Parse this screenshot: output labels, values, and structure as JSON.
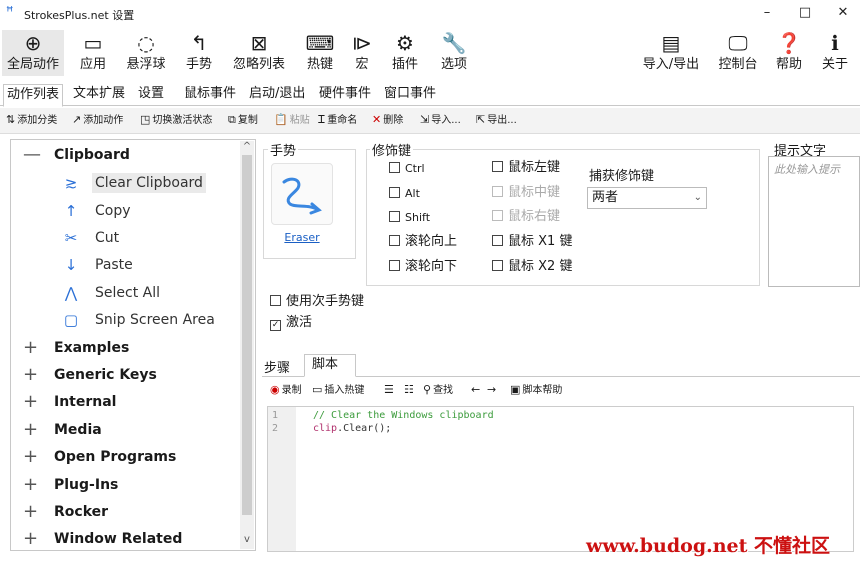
{
  "window": {
    "title": "StrokesPlus.net 设置",
    "minimize": "–",
    "maximize": "□",
    "close": "✕"
  },
  "toolbar": {
    "left": [
      {
        "label": "全局动作",
        "icon": "globe-icon",
        "glyph": "⊕"
      },
      {
        "label": "应用",
        "icon": "window-icon",
        "glyph": "▭"
      },
      {
        "label": "悬浮球",
        "icon": "circle-dots-icon",
        "glyph": "◌"
      },
      {
        "label": "手势",
        "icon": "gesture-arrow-icon",
        "glyph": "↰"
      },
      {
        "label": "忽略列表",
        "icon": "ignore-windows-icon",
        "glyph": "⊠"
      },
      {
        "label": "热键",
        "icon": "keyboard-icon",
        "glyph": "⌨"
      },
      {
        "label": "宏",
        "icon": "macro-icon",
        "glyph": "⧐"
      },
      {
        "label": "插件",
        "icon": "plugin-gear-icon",
        "glyph": "⚙"
      },
      {
        "label": "选项",
        "icon": "wrench-icon",
        "glyph": "🔧"
      }
    ],
    "right": [
      {
        "label": "导入/导出",
        "icon": "import-export-icon",
        "glyph": "▤"
      },
      {
        "label": "控制台",
        "icon": "console-icon",
        "glyph": "🖵"
      },
      {
        "label": "帮助",
        "icon": "help-doc-icon",
        "glyph": "❓"
      },
      {
        "label": "关于",
        "icon": "about-icon",
        "glyph": "ℹ"
      }
    ]
  },
  "tabs": [
    "动作列表",
    "文本扩展",
    "设置",
    "鼠标事件",
    "启动/退出",
    "硬件事件",
    "窗口事件"
  ],
  "actions": [
    {
      "label": "添加分类",
      "icon": "add-category-icon",
      "glyph": "⇅"
    },
    {
      "label": "添加动作",
      "icon": "add-action-icon",
      "glyph": "↗"
    },
    {
      "label": "切换激活状态",
      "icon": "toggle-active-icon",
      "glyph": "◳"
    },
    {
      "label": "复制",
      "icon": "copy-icon",
      "glyph": "⧉"
    },
    {
      "label": "粘贴",
      "icon": "paste-icon",
      "glyph": "📋"
    },
    {
      "label": "重命名",
      "icon": "rename-icon",
      "glyph": "Ꮖ"
    },
    {
      "label": "删除",
      "icon": "delete-icon",
      "glyph": "✕"
    },
    {
      "label": "导入...",
      "icon": "import-icon",
      "glyph": "⇲"
    },
    {
      "label": "导出...",
      "icon": "export-icon",
      "glyph": "⇱"
    }
  ],
  "tree": {
    "categories_top": [
      {
        "sign": "—",
        "name": "Clipboard"
      }
    ],
    "leaves": [
      {
        "name": "Clear Clipboard",
        "glyph": "≳"
      },
      {
        "name": "Copy",
        "glyph": "↑"
      },
      {
        "name": "Cut",
        "glyph": "✂"
      },
      {
        "name": "Paste",
        "glyph": "↓"
      },
      {
        "name": "Select All",
        "glyph": "⋀"
      },
      {
        "name": "Snip Screen Area",
        "glyph": "▢"
      }
    ],
    "categories": [
      {
        "sign": "+",
        "name": "Examples"
      },
      {
        "sign": "+",
        "name": "Generic Keys"
      },
      {
        "sign": "+",
        "name": "Internal"
      },
      {
        "sign": "+",
        "name": "Media"
      },
      {
        "sign": "+",
        "name": "Open Programs"
      },
      {
        "sign": "+",
        "name": "Plug-Ins"
      },
      {
        "sign": "+",
        "name": "Rocker"
      },
      {
        "sign": "+",
        "name": "Window Related"
      }
    ],
    "scroll_up": "^",
    "scroll_down": "v"
  },
  "gesture": {
    "header": "手势",
    "name": "Eraser"
  },
  "modifiers": {
    "header": "修饰键",
    "left": [
      {
        "label": "Ctrl",
        "checked": false
      },
      {
        "label": "Alt",
        "checked": false
      },
      {
        "label": "Shift",
        "checked": false
      },
      {
        "label": "滚轮向上",
        "checked": false
      },
      {
        "label": "滚轮向下",
        "checked": false
      }
    ],
    "right": [
      {
        "label": "鼠标左键",
        "checked": false,
        "disabled": false
      },
      {
        "label": "鼠标中键",
        "checked": false,
        "disabled": true
      },
      {
        "label": "鼠标右键",
        "checked": false,
        "disabled": true
      },
      {
        "label": "鼠标 X1 键",
        "checked": false,
        "disabled": false
      },
      {
        "label": "鼠标 X2 键",
        "checked": false,
        "disabled": false
      }
    ],
    "capture_label": "捕获修饰键",
    "capture_value": "两者"
  },
  "hint": {
    "header": "提示文字",
    "placeholder": "此处输入提示"
  },
  "options": [
    {
      "label": "使用次手势键",
      "checked": false
    },
    {
      "label": "激活",
      "checked": true
    }
  ],
  "script_tabs": [
    "步骤",
    "脚本"
  ],
  "script_toolbar": [
    {
      "label": "录制",
      "glyph": "◉"
    },
    {
      "label": "插入热键",
      "glyph": "▭"
    },
    {
      "label": "",
      "glyph": "☰"
    },
    {
      "label": "",
      "glyph": "☷"
    },
    {
      "label": "查找",
      "glyph": "⚲"
    },
    {
      "label": "",
      "glyph": "←"
    },
    {
      "label": "",
      "glyph": "→"
    },
    {
      "label": "脚本帮助",
      "glyph": "▣"
    }
  ],
  "code": {
    "lines": [
      {
        "n": "1",
        "parts": [
          {
            "t": "// Clear the Windows clipboard",
            "c": "#3b9b3b"
          }
        ]
      },
      {
        "n": "2",
        "parts": [
          {
            "t": "clip",
            "c": "#b0306c"
          },
          {
            "t": ".Clear();",
            "c": "#333333"
          }
        ]
      }
    ]
  },
  "watermark": "www.budog.net 不懂社区",
  "colors": {
    "accent": "#2a6fd6",
    "link": "#1a5fc4",
    "watermark": "#cc1111"
  }
}
